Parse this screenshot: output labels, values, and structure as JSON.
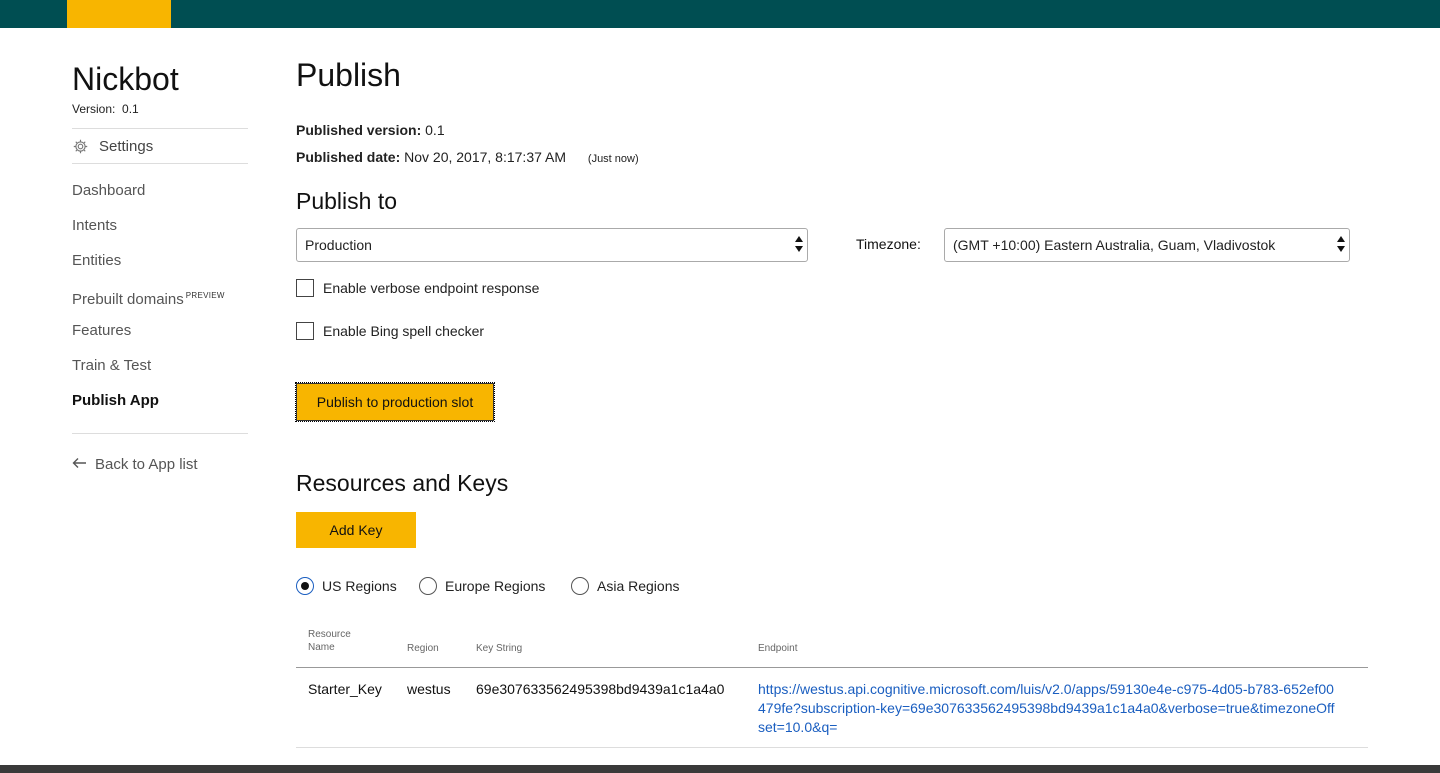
{
  "sidebar": {
    "app_name": "Nickbot",
    "version_label": "Version:",
    "version_value": "0.1",
    "settings_label": "Settings",
    "items": [
      {
        "label": "Dashboard"
      },
      {
        "label": "Intents"
      },
      {
        "label": "Entities"
      },
      {
        "label": "Prebuilt domains",
        "badge": "PREVIEW"
      },
      {
        "label": "Features"
      },
      {
        "label": "Train & Test"
      },
      {
        "label": "Publish App",
        "active": true
      }
    ],
    "back_label": "Back to App list"
  },
  "main": {
    "title": "Publish",
    "published_version_label": "Published version:",
    "published_version_value": "0.1",
    "published_date_label": "Published date:",
    "published_date_value": "Nov 20, 2017, 8:17:37 AM",
    "published_date_relative": "(Just now)",
    "publish_to_heading": "Publish to",
    "slot_select_value": "Production",
    "timezone_label": "Timezone:",
    "timezone_select_value": "(GMT +10:00) Eastern Australia, Guam, Vladivostok",
    "verbose_label": "Enable verbose endpoint response",
    "bing_label": "Enable Bing spell checker",
    "publish_button": "Publish to production slot",
    "resources_heading": "Resources and Keys",
    "add_key_button": "Add Key",
    "regions": [
      {
        "label": "US Regions",
        "selected": true
      },
      {
        "label": "Europe Regions",
        "selected": false
      },
      {
        "label": "Asia Regions",
        "selected": false
      }
    ],
    "table": {
      "headers": {
        "resource_name_line1": "Resource",
        "resource_name_line2": "Name",
        "region": "Region",
        "key_string": "Key String",
        "endpoint": "Endpoint"
      },
      "rows": [
        {
          "resource_name": "Starter_Key",
          "region": "westus",
          "key_string": "69e307633562495398bd9439a1c1a4a0",
          "endpoint": "https://westus.api.cognitive.microsoft.com/luis/v2.0/apps/59130e4e-c975-4d05-b783-652ef00479fe?subscription-key=69e307633562495398bd9439a1c1a4a0&verbose=true&timezoneOffset=10.0&q="
        }
      ]
    }
  },
  "colors": {
    "topbar": "#004e52",
    "accent": "#f8b500",
    "link": "#1a5ec0"
  },
  "icons": {
    "settings": "gear-icon",
    "back": "arrow-left-icon"
  }
}
